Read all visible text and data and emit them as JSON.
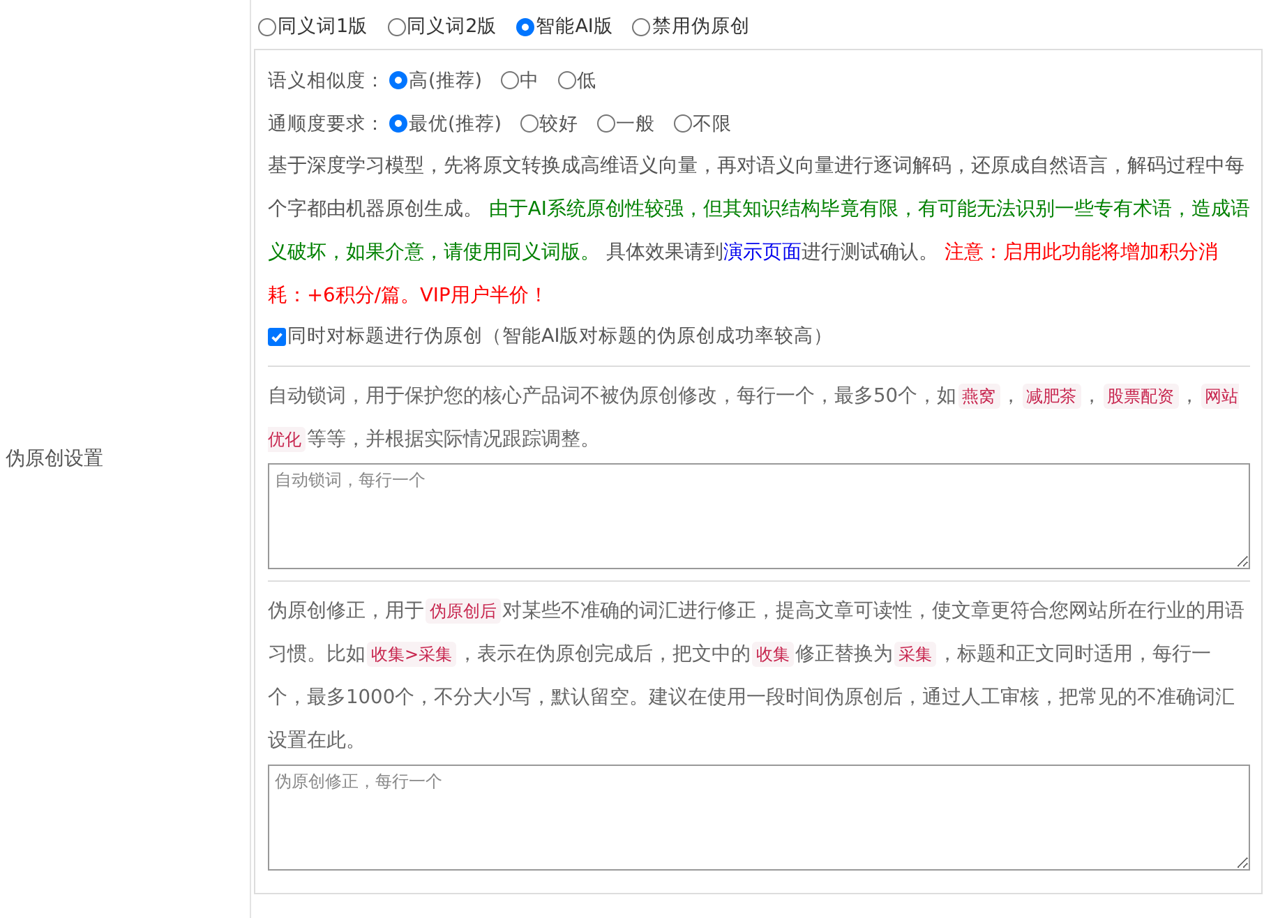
{
  "form_label": "伪原创设置",
  "modes": [
    {
      "label": "同义词1版",
      "selected": false
    },
    {
      "label": "同义词2版",
      "selected": false
    },
    {
      "label": "智能AI版",
      "selected": true
    },
    {
      "label": "禁用伪原创",
      "selected": false
    }
  ],
  "similarity": {
    "label": "语义相似度：",
    "options": [
      {
        "label": "高(推荐)",
        "selected": true
      },
      {
        "label": "中",
        "selected": false
      },
      {
        "label": "低",
        "selected": false
      }
    ]
  },
  "fluency": {
    "label": "通顺度要求：",
    "options": [
      {
        "label": "最优(推荐)",
        "selected": true
      },
      {
        "label": "较好",
        "selected": false
      },
      {
        "label": "一般",
        "selected": false
      },
      {
        "label": "不限",
        "selected": false
      }
    ]
  },
  "ai_description": [
    {
      "kind": "plain",
      "text": "基于深度学习模型，先将原文转换成高维语义向量，再对语义向量进行逐词解码，还原成自然语言，解码过程中每个字都由机器原创生成。 "
    },
    {
      "kind": "green",
      "text": "由于AI系统原创性较强，但其知识结构毕竟有限，有可能无法识别一些专有术语，造成语义破坏，如果介意，请使用同义词版。"
    },
    {
      "kind": "plain",
      "text": " 具体效果请到"
    },
    {
      "kind": "link",
      "text": "演示页面"
    },
    {
      "kind": "plain",
      "text": "进行测试确认。 "
    },
    {
      "kind": "red",
      "text": "注意：启用此功能将增加积分消耗：+6积分/篇。VIP用户半价！"
    }
  ],
  "title_option": {
    "label": "同时对标题进行伪原创（智能AI版对标题的伪原创成功率较高）",
    "checked": true
  },
  "lock_words": {
    "description": [
      {
        "kind": "plain",
        "text": "自动锁词，用于保护您的核心产品词不被伪原创修改，每行一个，最多50个，如"
      },
      {
        "kind": "code",
        "text": "燕窝"
      },
      {
        "kind": "plain",
        "text": "，"
      },
      {
        "kind": "code",
        "text": "减肥茶"
      },
      {
        "kind": "plain",
        "text": "，"
      },
      {
        "kind": "code",
        "text": "股票配资"
      },
      {
        "kind": "plain",
        "text": "，"
      },
      {
        "kind": "code",
        "text": "网站优化"
      },
      {
        "kind": "plain",
        "text": "等等，并根据实际情况跟踪调整。"
      }
    ],
    "placeholder": "自动锁词，每行一个"
  },
  "corrections": {
    "description": [
      {
        "kind": "plain",
        "text": "伪原创修正，用于"
      },
      {
        "kind": "code",
        "text": "伪原创后"
      },
      {
        "kind": "plain",
        "text": "对某些不准确的词汇进行修正，提高文章可读性，使文章更符合您网站所在行业的用语习惯。比如"
      },
      {
        "kind": "code",
        "text": "收集>采集"
      },
      {
        "kind": "plain",
        "text": "，表示在伪原创完成后，把文中的"
      },
      {
        "kind": "code",
        "text": "收集"
      },
      {
        "kind": "plain",
        "text": "修正替换为"
      },
      {
        "kind": "code",
        "text": "采集"
      },
      {
        "kind": "plain",
        "text": "，标题和正文同时适用，每行一个，最多1000个，不分大小写，默认留空。建议在使用一段时间伪原创后，通过人工审核，把常见的不准确词汇设置在此。"
      }
    ],
    "placeholder": "伪原创修正，每行一个"
  }
}
